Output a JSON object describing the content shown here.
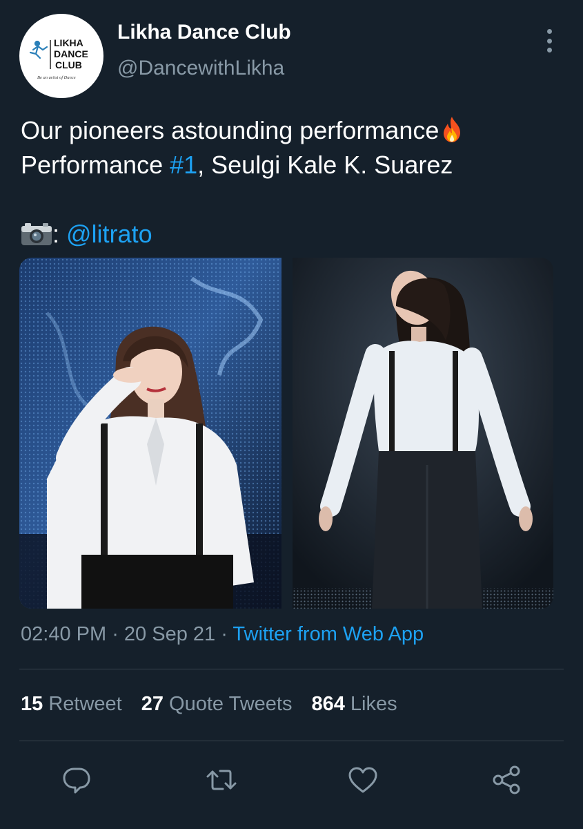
{
  "author": {
    "name": "Likha Dance Club",
    "handle": "@DancewithLikha",
    "avatar_text": [
      "LIKHA",
      "DANCE",
      "CLUB"
    ],
    "avatar_tagline": "Be an artist of Dance"
  },
  "tweet": {
    "line1": "Our pioneers astounding performance",
    "line2_prefix": "Performance ",
    "hashtag": "#1",
    "line2_suffix": ", Seulgi Kale K. Suarez",
    "credit_colon": ": ",
    "mention": "@litrato",
    "emoji": [
      "fire",
      "camera-with-flash"
    ]
  },
  "meta": {
    "time": "02:40 PM",
    "sep1": " · ",
    "date": "20 Sep 21",
    "sep2": " · ",
    "source": "Twitter from Web App"
  },
  "stats": {
    "retweets_count": "15",
    "retweets_label": "Retweet",
    "quotes_count": "27",
    "quotes_label": "Quote Tweets",
    "likes_count": "864",
    "likes_label": "Likes"
  },
  "icons": [
    "more-vertical-icon",
    "reply-icon",
    "retweet-icon",
    "like-icon",
    "share-icon"
  ],
  "colors": {
    "background": "#15202b",
    "text": "#ffffff",
    "secondary": "#8899a6",
    "accent": "#1da1f2",
    "divider": "#38444d"
  }
}
